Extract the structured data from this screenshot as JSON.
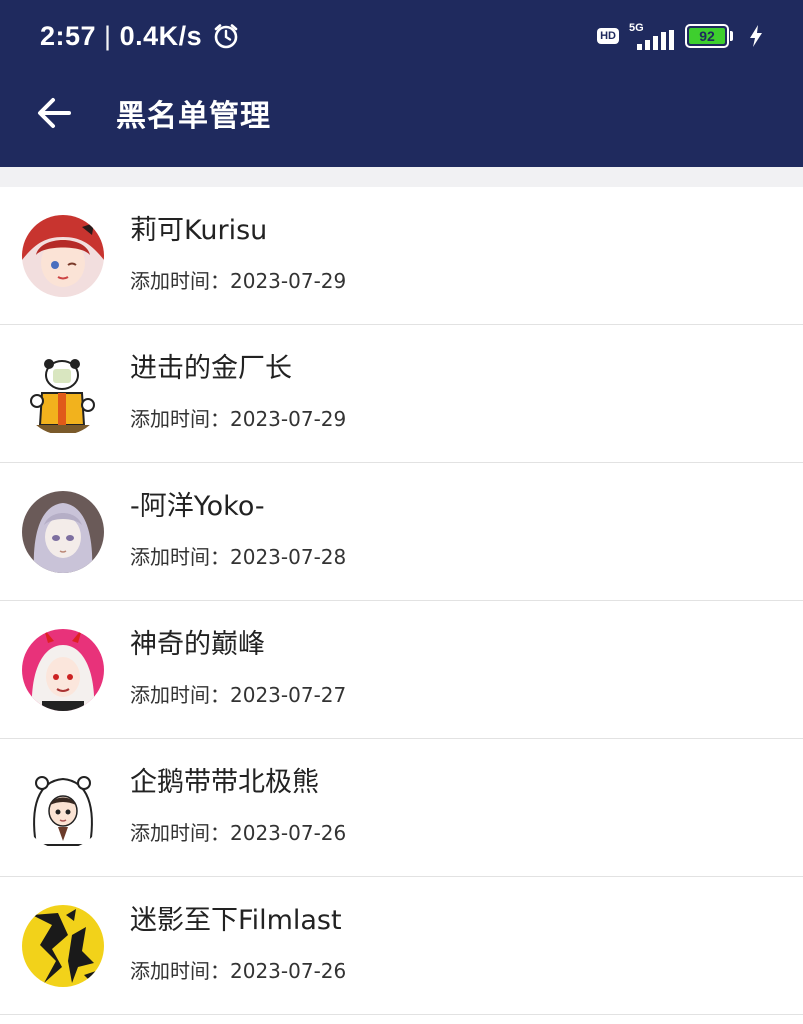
{
  "status_bar": {
    "time": "2:57",
    "separator": "|",
    "net_speed": "0.4K/s",
    "hd_badge": "HD",
    "signal_label": "5G",
    "battery_level": "92",
    "icons": [
      "alarm-icon",
      "hd-icon",
      "signal-icon",
      "battery-icon",
      "charging-bolt-icon"
    ]
  },
  "header": {
    "title": "黑名单管理",
    "back_icon": "arrow-left-icon"
  },
  "colors": {
    "header_bg": "#1f2a5e",
    "battery_green": "#3ecf2e",
    "divider": "#e2e2e2"
  },
  "blacklist": [
    {
      "name": "莉可Kurisu",
      "added": "添加时间：2023-07-29"
    },
    {
      "name": "进击的金厂长",
      "added": "添加时间：2023-07-29"
    },
    {
      "name": "-阿洋Yoko-",
      "added": "添加时间：2023-07-28"
    },
    {
      "name": "神奇的巅峰",
      "added": "添加时间：2023-07-27"
    },
    {
      "name": "企鹅带带北极熊",
      "added": "添加时间：2023-07-26"
    },
    {
      "name": "迷影至下Filmlast",
      "added": "添加时间：2023-07-26"
    }
  ]
}
